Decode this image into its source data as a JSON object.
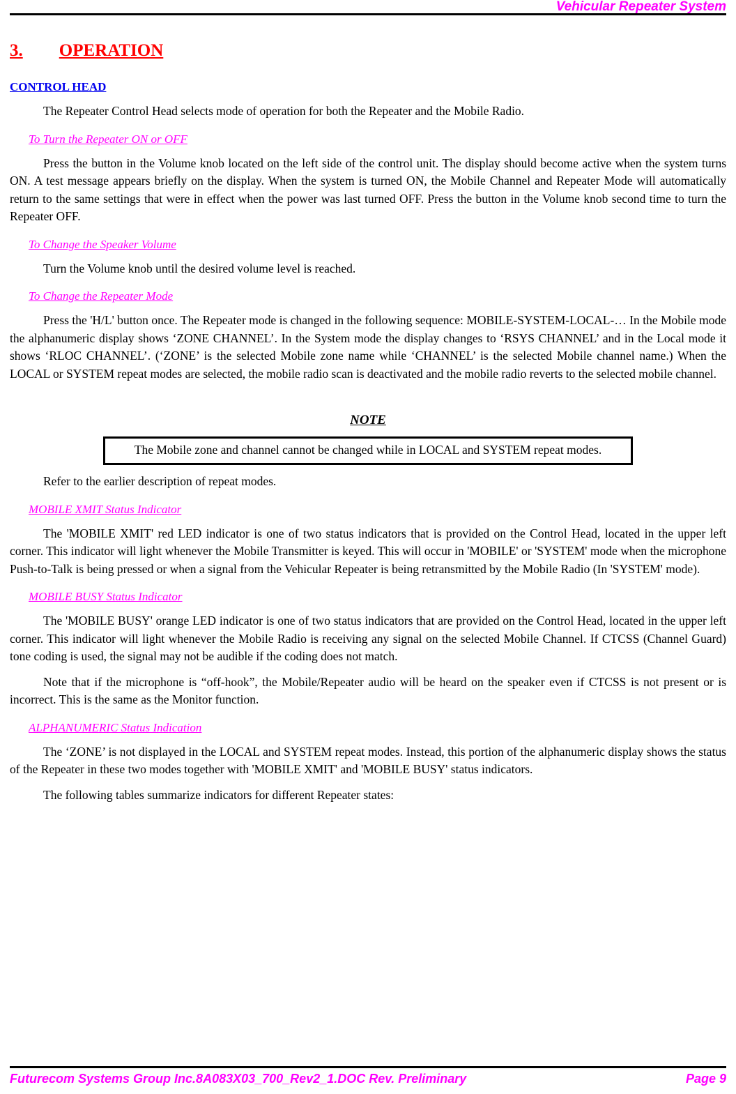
{
  "header": {
    "title": "Vehicular Repeater System"
  },
  "section": {
    "number": "3.",
    "title": "OPERATION"
  },
  "control_head": {
    "heading": "CONTROL HEAD",
    "intro": "The Repeater Control Head selects mode of operation for both the Repeater and the Mobile Radio.",
    "subsections": [
      {
        "heading": "To Turn the Repeater ON or OFF",
        "body": "Press the button in the Volume knob located on the left side of the control unit. The display should become active when the system turns ON. A test message appears briefly on the display. When the system is turned ON, the Mobile Channel and Repeater Mode will automatically return to the same settings that were in effect when the power was last turned OFF. Press the button in the Volume knob second time to turn the Repeater OFF."
      },
      {
        "heading": "To Change the Speaker Volume",
        "body": "Turn the Volume knob until the desired volume level is reached."
      },
      {
        "heading": "To Change the Repeater Mode",
        "body": "Press the 'H/L' button once. The Repeater mode is changed in the following sequence: MOBILE-SYSTEM-LOCAL-… In the Mobile mode the alphanumeric display shows ‘ZONE CHANNEL’. In the System mode the display changes to ‘RSYS CHANNEL’ and in the Local mode it shows ‘RLOC CHANNEL’. (‘ZONE’ is the selected Mobile zone name while ‘CHANNEL’ is the selected Mobile channel name.) When the LOCAL or SYSTEM repeat modes are selected, the mobile radio scan is deactivated and the mobile radio reverts to the selected mobile channel."
      }
    ]
  },
  "note": {
    "title": "NOTE",
    "text": "The Mobile zone and channel cannot be changed while in LOCAL and SYSTEM repeat modes."
  },
  "after_note": {
    "text": "Refer to the earlier description of repeat modes."
  },
  "indicators": [
    {
      "heading": "MOBILE XMIT Status Indicator",
      "body": "The 'MOBILE XMIT' red LED indicator is one of two status indicators that is provided on the Control Head, located in the upper left corner. This indicator will light whenever the Mobile Transmitter is keyed. This will occur in 'MOBILE' or 'SYSTEM' mode when the microphone Push-to-Talk is being pressed or when a signal from the Vehicular Repeater is being retransmitted by the Mobile Radio (In 'SYSTEM' mode)."
    },
    {
      "heading": "MOBILE BUSY Status Indicator",
      "body": "The 'MOBILE BUSY' orange LED indicator is one of two status indicators that are provided on the Control Head, located in the upper left corner. This indicator will light whenever the Mobile Radio is receiving any signal on the selected Mobile Channel. If CTCSS (Channel Guard) tone coding is used, the signal may not be audible if the coding does not match.",
      "body2": "Note that if the microphone is “off-hook”, the Mobile/Repeater audio will be heard on the speaker even if CTCSS is not present or is incorrect. This is the same as the Monitor function."
    },
    {
      "heading": "ALPHANUMERIC Status Indication",
      "body": "The ‘ZONE’ is not displayed in the LOCAL and SYSTEM repeat modes. Instead, this portion of the alphanumeric display shows the status of the Repeater in these two modes together with 'MOBILE XMIT' and 'MOBILE BUSY' status indicators."
    }
  ],
  "closing": {
    "text": "The following tables summarize indicators for different Repeater states:"
  },
  "footer": {
    "text": "Futurecom Systems Group Inc.8A083X03_700_Rev2_1.DOC Rev. Preliminary",
    "page": "Page 9"
  },
  "colors": {
    "header_magenta": "#FF00FF",
    "section_red": "#FF0000",
    "subsection_blue": "#0000EE",
    "run_heading_magenta": "#FF00FF",
    "body_black": "#000000",
    "rule_black": "#000000"
  }
}
